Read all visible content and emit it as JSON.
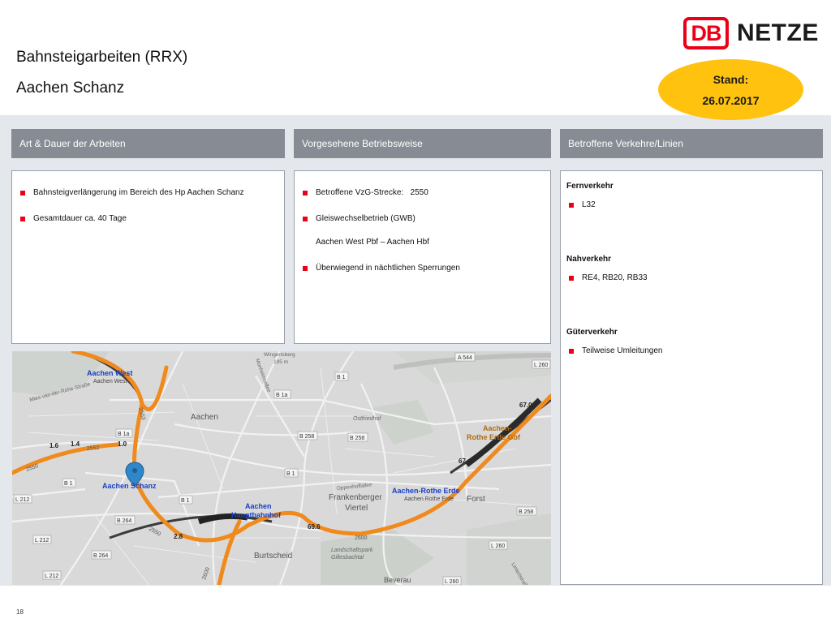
{
  "header": {
    "title": "Bahnsteigarbeiten (RRX)",
    "subtitle": "Aachen Schanz",
    "logo_text": "NETZE",
    "logo_mark": "DB",
    "stand_label": "Stand:",
    "stand_date": "26.07.2017"
  },
  "columns": {
    "art_header": "Art & Dauer der Arbeiten",
    "betrieb_header": "Vorgesehene Betriebsweise",
    "verkehre_header": "Betroffene Verkehre/Linien"
  },
  "art": {
    "item1": "Bahnsteigverlängerung im Bereich des Hp Aachen Schanz",
    "item2": "Gesamtdauer ca. 40 Tage"
  },
  "betrieb": {
    "item1": "Betroffene VzG-Strecke:   2550",
    "item2": "Gleiswechselbetrieb (GWB)",
    "item2_detail": "Aachen West Pbf – Aachen Hbf",
    "item3": "Überwiegend in nächtlichen Sperrungen"
  },
  "verkehre": {
    "fern_heading": "Fernverkehr",
    "fern_item": "L32",
    "nah_heading": "Nahverkehr",
    "nah_item": "RE4, RB20, RB33",
    "gueter_heading": "Güterverkehr",
    "gueter_item": "Teilweise Umleitungen"
  },
  "map": {
    "stations": {
      "aachen_west": "Aachen West",
      "aachen_west_small": "Aachen West",
      "aachen_schanz": "Aachen Schanz",
      "hbf_line1": "Aachen",
      "hbf_line2": "Hauptbahnhof",
      "rothe_erde": "Aachen-Rothe Erde",
      "rothe_erde_small": "Aachen Rothe Erde",
      "rothe_gbf_line1": "Aachen-",
      "rothe_gbf_line2": "Rothe Erde Gbf"
    },
    "places": {
      "aachen": "Aachen",
      "frankenberger1": "Frankenberger",
      "frankenberger2": "Viertel",
      "burtscheid": "Burtscheid",
      "forst": "Forst",
      "beverau": "Beverau",
      "ostfriedhof": "Ostfriedhof",
      "landschaftspark1": "Landschaftspark",
      "landschaftspark2": "Gillesbachtal",
      "wingertsberg": "Wingertsberg",
      "elevation": "195 m",
      "oppenhoffallee": "Oppenhoffallee",
      "mies": "Mies-van-der-Rohe-Straße",
      "lutherstr": "Lintertstraße",
      "monheim": "Monheimsallee"
    },
    "roads": {
      "a544": "A 544",
      "l260_top": "L 260",
      "b1_top": "B 1",
      "b1a_top": "B 1a",
      "b1a_mid": "B 1a",
      "b1_left": "B 1",
      "b1_center": "B 1",
      "b1_right": "B 1",
      "b258_center": "B 258",
      "b258_mid": "B 258",
      "b258_right": "B 258",
      "b264_a": "B 264",
      "b264_b": "B 264",
      "l212_a": "L 212",
      "l212_b": "L 212",
      "l212_c": "L 212",
      "l260_bottom": "L 260",
      "l260_bottom2": "L 260"
    },
    "km": {
      "k1": "1.6",
      "k2": "1.4",
      "k3": "1.0",
      "k4": "2.8",
      "k5": "69.6",
      "k6": "67.0",
      "k7": "67.",
      "k8": "2553"
    },
    "line_numbers": {
      "n2550a": "2550",
      "n2552": "2552",
      "n2600": "2600",
      "n2600b": "2600",
      "n2553": "2553",
      "n2550b": "2550"
    },
    "colors": {
      "track": "#f08a1d",
      "station_label": "#1a3fc4",
      "pin": "#2f86c9"
    }
  },
  "footer": {
    "page_number": "18"
  }
}
